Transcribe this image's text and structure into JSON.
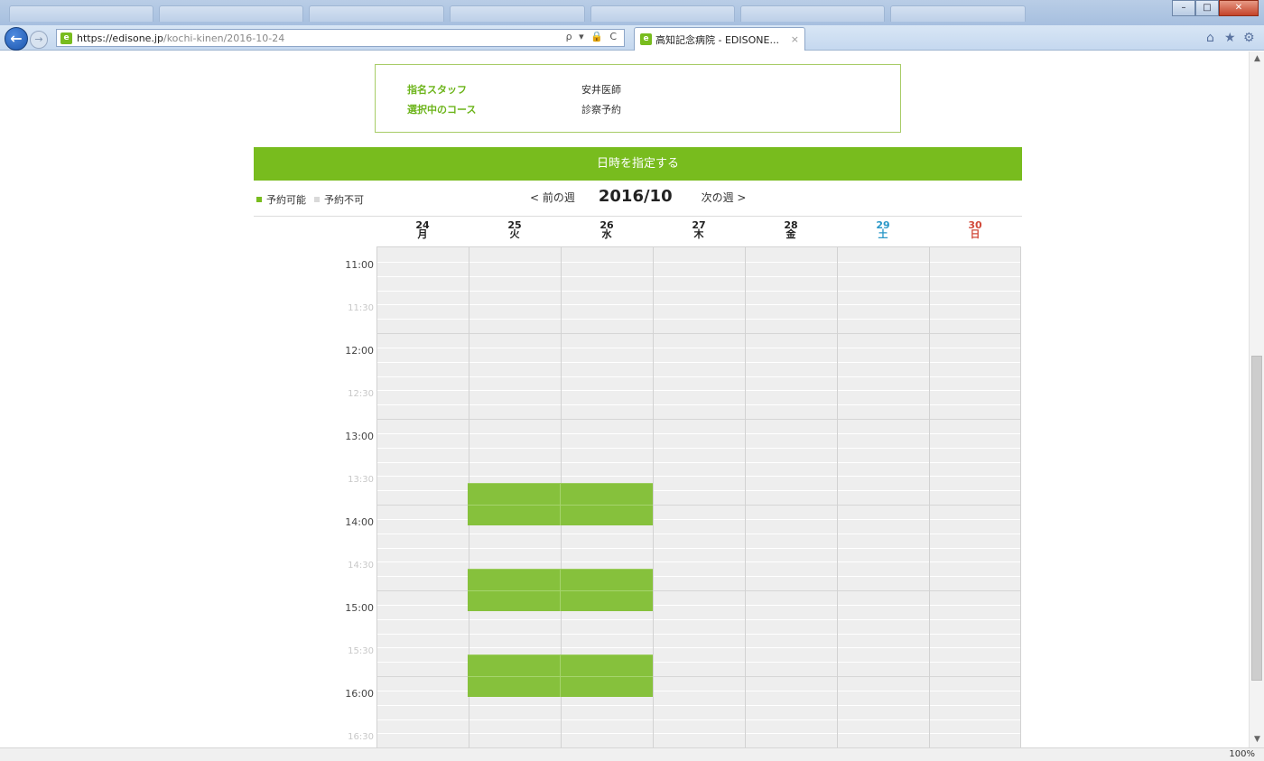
{
  "browser": {
    "url_host": "https://edisone.jp",
    "url_path": "/kochi-kinen/2016-10-24",
    "tab_title": "高知記念病院 - EDISONE...",
    "tab_close": "×",
    "back": "←",
    "forward": "→",
    "address_tools": "ρ ▾ 🔒 C",
    "zoom": "100%",
    "minimize": "–",
    "maximize": "□",
    "close": "✕"
  },
  "info": {
    "staff_label": "指名スタッフ",
    "staff_value": "安井医師",
    "course_label": "選択中のコース",
    "course_value": "診察予約"
  },
  "banner": {
    "title": "日時を指定する"
  },
  "legend": {
    "available": "予約可能",
    "unavailable": "予約不可"
  },
  "week_nav": {
    "prev": "< 前の週",
    "month": "2016/10",
    "next": "次の週 >"
  },
  "days": [
    {
      "date": "24",
      "weekday": "月"
    },
    {
      "date": "25",
      "weekday": "火"
    },
    {
      "date": "26",
      "weekday": "水"
    },
    {
      "date": "27",
      "weekday": "木"
    },
    {
      "date": "28",
      "weekday": "金"
    },
    {
      "date": "29",
      "weekday": "土"
    },
    {
      "date": "30",
      "weekday": "日"
    }
  ],
  "times": [
    "11:00",
    "11:30",
    "12:00",
    "12:30",
    "13:00",
    "13:30",
    "14:00",
    "14:30",
    "15:00",
    "15:30",
    "16:00",
    "16:30"
  ],
  "available_slots": [
    {
      "days": [
        "25",
        "26"
      ],
      "time": "13:30"
    },
    {
      "days": [
        "25",
        "26"
      ],
      "time": "14:30"
    },
    {
      "days": [
        "25",
        "26"
      ],
      "time": "15:30"
    }
  ],
  "colors": {
    "accent": "#78bc1e",
    "available": "#86c13c",
    "unavailable": "#eeeeee",
    "saturday": "#2a98c8",
    "sunday": "#d24a3a"
  }
}
